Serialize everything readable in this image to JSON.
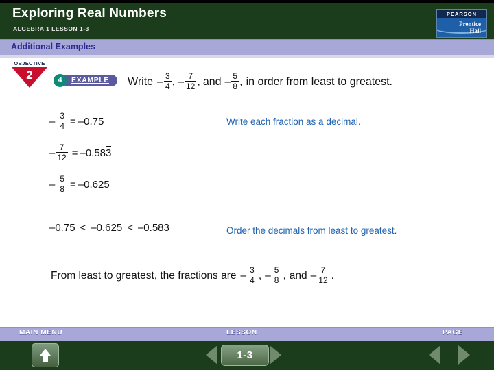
{
  "header": {
    "title": "Exploring Real Numbers",
    "subtitle": "ALGEBRA 1  LESSON 1-3",
    "logo": {
      "brand": "PEARSON",
      "line1": "Prentice",
      "line2": "Hall"
    }
  },
  "band": {
    "label": "Additional Examples"
  },
  "objective": {
    "label": "OBJECTIVE",
    "number": "2"
  },
  "example": {
    "number": "4",
    "label": "EXAMPLE"
  },
  "problem": {
    "lead": "Write",
    "minus": "–",
    "comma": ",",
    "and": "and",
    "tail": "in order from least to greatest.",
    "fractions": [
      {
        "num": "3",
        "den": "4"
      },
      {
        "num": "7",
        "den": "12"
      },
      {
        "num": "5",
        "den": "8"
      }
    ]
  },
  "steps": {
    "annotation": "Write each fraction as a decimal.",
    "rows": [
      {
        "sign": "–",
        "num": "3",
        "den": "4",
        "equals": "=",
        "value_sign": "–",
        "value": "0.75",
        "repeat": ""
      },
      {
        "sign": "–",
        "num": "7",
        "den": "12",
        "equals": "=",
        "value_sign": "–",
        "value": "0.58",
        "repeat": "3"
      },
      {
        "sign": "–",
        "num": "5",
        "den": "8",
        "equals": "=",
        "value_sign": "–",
        "value": "0.625",
        "repeat": ""
      }
    ]
  },
  "ordering": {
    "annotation": "Order the decimals from least to greatest.",
    "first": "–0.75",
    "op1": "<",
    "second": "–0.625",
    "op2": "<",
    "third_base": "–0.58",
    "third_repeat": "3"
  },
  "conclusion": {
    "lead": "From least to greatest, the fractions are",
    "minus": "–",
    "comma": ",",
    "and": "and",
    "period": ".",
    "fractions": [
      {
        "num": "3",
        "den": "4"
      },
      {
        "num": "5",
        "den": "8"
      },
      {
        "num": "7",
        "den": "12"
      }
    ]
  },
  "footer": {
    "main_menu_label": "MAIN MENU",
    "lesson_label": "LESSON",
    "page_label": "PAGE",
    "lesson_number": "1-3"
  },
  "colors": {
    "header_green": "#1b3d1c",
    "band_periwinkle": "#a8a8d8",
    "annotation_blue": "#1f63b0",
    "objective_red": "#c8102e",
    "example_teal": "#0d8a78",
    "example_purple": "#5a5a9e"
  }
}
